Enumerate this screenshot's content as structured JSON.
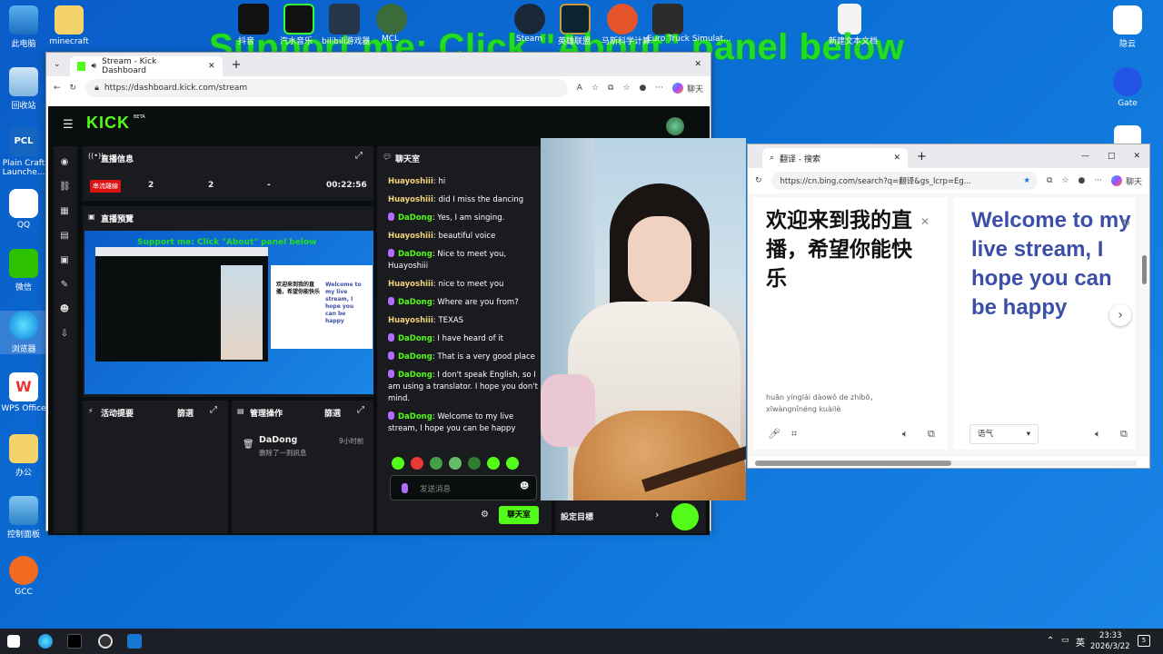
{
  "overlay": {
    "text": "Support me: Click \"About\" panel below"
  },
  "desktop": {
    "left_icons": [
      "此电脑",
      "minecraft",
      "回收站",
      "Plain Craft Launche...",
      "QQ",
      "微信",
      "浏览器",
      "WPS Office",
      "办公",
      "控制面板",
      "GCC"
    ],
    "top_labels": [
      "抖音",
      "汽水音乐",
      "bilibili游戏器",
      "MCL",
      "Steam",
      "英雄联盟",
      "马斯科学计算",
      "Euro Truck Simulat..."
    ],
    "right_icons": [
      "隐云",
      "Gate",
      "新建文本文档"
    ]
  },
  "browser1": {
    "tab_title": "Stream - Kick Dashboard",
    "url": "https://dashboard.kick.com/stream",
    "chat_btn": "聊天"
  },
  "kick": {
    "logo": "KICK",
    "beta": "BETA",
    "stream_info": {
      "title": "直播信息",
      "live_badge": "串流離線",
      "stat1": "2",
      "stat2": "2",
      "stat3": "-",
      "time": "00:22:56"
    },
    "preview": {
      "title": "直播預覽",
      "overlay": "Support me: Click \"About\" panel below",
      "zh": "欢迎来到我的直播，希望你能快乐",
      "en": "Welcome to my live stream, I hope you can be happy"
    },
    "activity": {
      "title": "活动提要",
      "filter": "篩選"
    },
    "mod": {
      "title": "管理操作",
      "filter": "篩選",
      "user": "DaDong",
      "action": "删除了一则訊息",
      "time": "9小时前"
    },
    "chat": {
      "title": "聊天室",
      "messages": [
        {
          "user": "Huayoshiii",
          "text": ": hi",
          "type": "h"
        },
        {
          "user": "Huayoshiii",
          "text": ": did I miss the dancing",
          "type": "h"
        },
        {
          "user": "DaDong",
          "text": ": Yes, I am singing.",
          "type": "d"
        },
        {
          "user": "Huayoshiii",
          "text": ": beautiful voice",
          "type": "h"
        },
        {
          "user": "DaDong",
          "text": ": Nice to meet you, Huayoshiii",
          "type": "d"
        },
        {
          "user": "Huayoshiii",
          "text": ": nice to meet you",
          "type": "h"
        },
        {
          "user": "DaDong",
          "text": ": Where are you from?",
          "type": "d"
        },
        {
          "user": "Huayoshiii",
          "text": ": TEXAS",
          "type": "h"
        },
        {
          "user": "DaDong",
          "text": ": I have heard of it",
          "type": "d"
        },
        {
          "user": "DaDong",
          "text": ": That is a very good place",
          "type": "d"
        },
        {
          "user": "DaDong",
          "text": ": I don't speak English, so I am using a translator. I hope you don't mind.",
          "type": "d"
        },
        {
          "user": "DaDong",
          "text": ": Welcome to my live stream, I hope you can be happy",
          "type": "d"
        }
      ],
      "input_placeholder": "发送消息",
      "send_btn": "聊天室"
    },
    "goal": "設定目標"
  },
  "bing": {
    "tab_title": "翻译 - 搜索",
    "url": "https://cn.bing.com/search?q=翻译&gs_lcrp=Eg...",
    "chat_btn": "聊天",
    "source_text": "欢迎来到我的直播，希望你能快乐",
    "pinyin": "huān yínglái dàowǒ de zhíbō，xīwàngnǐnéng kuàilè",
    "target_text": "Welcome to my live stream, I hope you can be happy",
    "tone_select": "语气"
  },
  "taskbar": {
    "lang": "英",
    "time": "23:33",
    "date": "2026/3/22",
    "badge": "5"
  },
  "colors": {
    "kick_green": "#53fc18",
    "overlay_green": "#22dd22",
    "bing_blue": "#3c4fa6"
  }
}
